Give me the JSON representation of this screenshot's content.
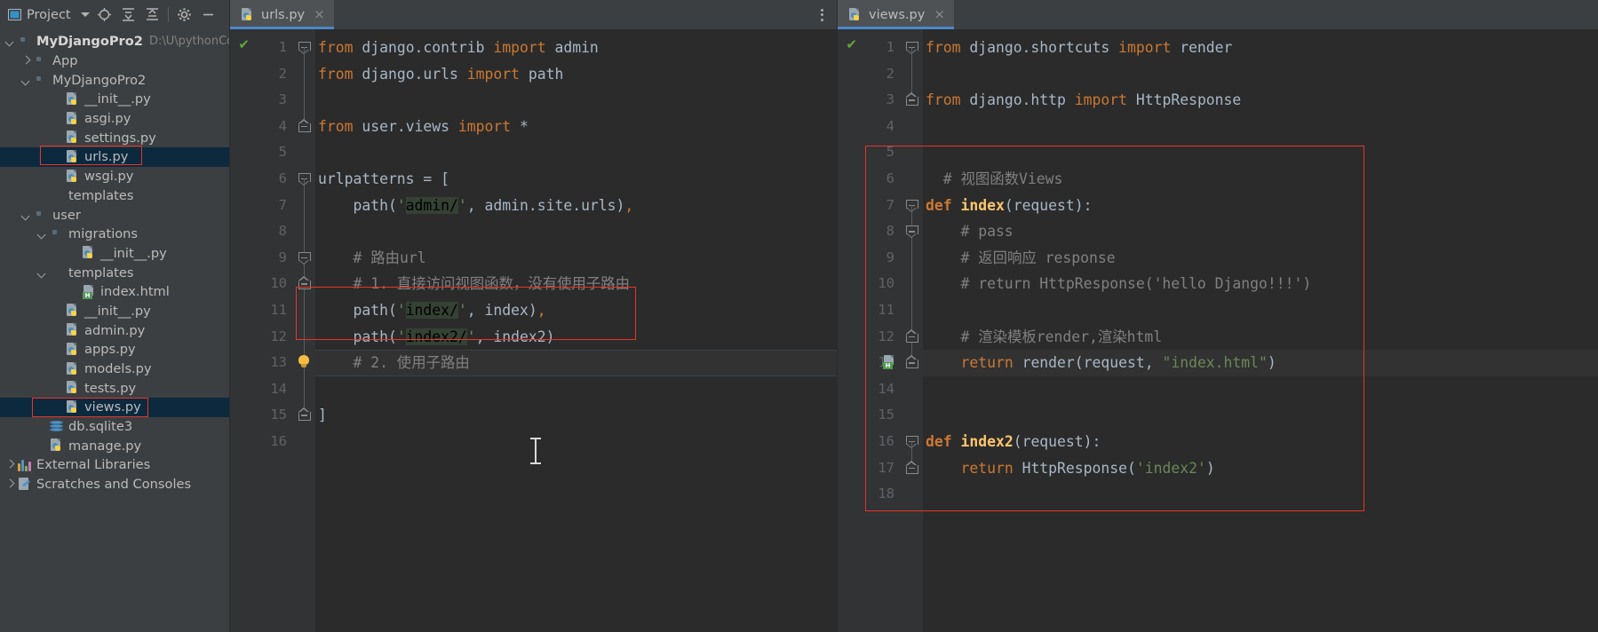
{
  "sidebar": {
    "toolbar": {
      "title": "Project",
      "dropdown_icon": "chevron-down-icon",
      "buttons": [
        {
          "name": "locate-icon",
          "glyph": "⊕"
        },
        {
          "name": "expand-all-icon",
          "glyph": "⤓"
        },
        {
          "name": "collapse-all-icon",
          "glyph": "⤒"
        },
        {
          "name": "settings-gear-icon",
          "glyph": "⚙"
        },
        {
          "name": "hide-icon",
          "glyph": "—"
        }
      ]
    },
    "tree": [
      {
        "label": "MyDjangoPro2",
        "path": "D:\\U\\pythonCode",
        "indent": 0,
        "arrow": "down",
        "icon": "folder-module",
        "bold": true,
        "selected": false
      },
      {
        "label": "App",
        "path": "",
        "indent": 1,
        "arrow": "right",
        "icon": "folder-module",
        "bold": false,
        "selected": false
      },
      {
        "label": "MyDjangoPro2",
        "path": "",
        "indent": 1,
        "arrow": "down",
        "icon": "folder-module",
        "bold": false,
        "selected": false
      },
      {
        "label": "__init__.py",
        "path": "",
        "indent": 3,
        "arrow": "none",
        "icon": "python-file",
        "bold": false,
        "selected": false
      },
      {
        "label": "asgi.py",
        "path": "",
        "indent": 3,
        "arrow": "none",
        "icon": "python-file",
        "bold": false,
        "selected": false
      },
      {
        "label": "settings.py",
        "path": "",
        "indent": 3,
        "arrow": "none",
        "icon": "python-file",
        "bold": false,
        "selected": false
      },
      {
        "label": "urls.py",
        "path": "",
        "indent": 3,
        "arrow": "none",
        "icon": "python-file",
        "bold": false,
        "selected": true
      },
      {
        "label": "wsgi.py",
        "path": "",
        "indent": 3,
        "arrow": "none",
        "icon": "python-file",
        "bold": false,
        "selected": false
      },
      {
        "label": "templates",
        "path": "",
        "indent": 2,
        "arrow": "none",
        "icon": "folder-purple",
        "bold": false,
        "selected": false
      },
      {
        "label": "user",
        "path": "",
        "indent": 1,
        "arrow": "down",
        "icon": "folder-module",
        "bold": false,
        "selected": false
      },
      {
        "label": "migrations",
        "path": "",
        "indent": 2,
        "arrow": "down",
        "icon": "folder-module",
        "bold": false,
        "selected": false
      },
      {
        "label": "__init__.py",
        "path": "",
        "indent": 4,
        "arrow": "none",
        "icon": "python-file",
        "bold": false,
        "selected": false
      },
      {
        "label": "templates",
        "path": "",
        "indent": 2,
        "arrow": "down",
        "icon": "folder-gray",
        "bold": false,
        "selected": false
      },
      {
        "label": "index.html",
        "path": "",
        "indent": 4,
        "arrow": "none",
        "icon": "html-file",
        "bold": false,
        "selected": false
      },
      {
        "label": "__init__.py",
        "path": "",
        "indent": 3,
        "arrow": "none",
        "icon": "python-file",
        "bold": false,
        "selected": false
      },
      {
        "label": "admin.py",
        "path": "",
        "indent": 3,
        "arrow": "none",
        "icon": "python-file",
        "bold": false,
        "selected": false
      },
      {
        "label": "apps.py",
        "path": "",
        "indent": 3,
        "arrow": "none",
        "icon": "python-file",
        "bold": false,
        "selected": false
      },
      {
        "label": "models.py",
        "path": "",
        "indent": 3,
        "arrow": "none",
        "icon": "python-file",
        "bold": false,
        "selected": false
      },
      {
        "label": "tests.py",
        "path": "",
        "indent": 3,
        "arrow": "none",
        "icon": "python-file",
        "bold": false,
        "selected": false
      },
      {
        "label": "views.py",
        "path": "",
        "indent": 3,
        "arrow": "none",
        "icon": "python-file",
        "bold": false,
        "selected": true
      },
      {
        "label": "db.sqlite3",
        "path": "",
        "indent": 2,
        "arrow": "none",
        "icon": "database-file",
        "bold": false,
        "selected": false
      },
      {
        "label": "manage.py",
        "path": "",
        "indent": 2,
        "arrow": "none",
        "icon": "python-file",
        "bold": false,
        "selected": false
      },
      {
        "label": "External Libraries",
        "path": "",
        "indent": 0,
        "arrow": "right",
        "icon": "library-icon",
        "bold": false,
        "selected": false
      },
      {
        "label": "Scratches and Consoles",
        "path": "",
        "indent": 0,
        "arrow": "right",
        "icon": "scratch-icon",
        "bold": false,
        "selected": false
      }
    ]
  },
  "left_editor": {
    "tab": {
      "label": "urls.py",
      "icon": "python-file",
      "close_glyph": "×",
      "active": true
    },
    "kebab_icon": "more-options-icon",
    "inspection_status": "✔",
    "line_numbers": [
      "1",
      "2",
      "3",
      "4",
      "5",
      "6",
      "7",
      "8",
      "9",
      "10",
      "11",
      "12",
      "13",
      "14",
      "15",
      "16"
    ],
    "lines": [
      {
        "n": 1,
        "tokens": [
          {
            "t": "from",
            "c": "kw"
          },
          {
            "t": " django.contrib ",
            "c": "txt"
          },
          {
            "t": "import",
            "c": "kw"
          },
          {
            "t": " admin",
            "c": "txt"
          }
        ]
      },
      {
        "n": 2,
        "tokens": [
          {
            "t": "from",
            "c": "kw"
          },
          {
            "t": " django.urls ",
            "c": "txt"
          },
          {
            "t": "import",
            "c": "kw"
          },
          {
            "t": " path",
            "c": "txt"
          }
        ]
      },
      {
        "n": 3,
        "tokens": []
      },
      {
        "n": 4,
        "tokens": [
          {
            "t": "from",
            "c": "kw"
          },
          {
            "t": " user.views ",
            "c": "txt"
          },
          {
            "t": "import",
            "c": "kw"
          },
          {
            "t": " *",
            "c": "txt"
          }
        ]
      },
      {
        "n": 5,
        "tokens": []
      },
      {
        "n": 6,
        "tokens": [
          {
            "t": "urlpatterns = [",
            "c": "txt"
          }
        ]
      },
      {
        "n": 7,
        "tokens": [
          {
            "t": "    path(",
            "c": "txt"
          },
          {
            "t": "'",
            "c": "str"
          },
          {
            "t": "admin/",
            "c": "hlstr"
          },
          {
            "t": "'",
            "c": "str"
          },
          {
            "t": ", admin.site.urls)",
            "c": "txt"
          },
          {
            "t": ",",
            "c": "kw"
          }
        ]
      },
      {
        "n": 8,
        "tokens": []
      },
      {
        "n": 9,
        "tokens": [
          {
            "t": "    # 路由url",
            "c": "cmt"
          }
        ]
      },
      {
        "n": 10,
        "tokens": [
          {
            "t": "    # 1. 直接访问视图函数，没有使用子路由",
            "c": "cmt"
          }
        ]
      },
      {
        "n": 11,
        "tokens": [
          {
            "t": "    path(",
            "c": "txt"
          },
          {
            "t": "'",
            "c": "str"
          },
          {
            "t": "index/",
            "c": "hlstr"
          },
          {
            "t": "'",
            "c": "str"
          },
          {
            "t": ", index)",
            "c": "txt"
          },
          {
            "t": ",",
            "c": "kw"
          }
        ]
      },
      {
        "n": 12,
        "tokens": [
          {
            "t": "    path(",
            "c": "txt"
          },
          {
            "t": "'",
            "c": "str"
          },
          {
            "t": "index2/",
            "c": "hlstr"
          },
          {
            "t": "'",
            "c": "str"
          },
          {
            "t": ", index2)",
            "c": "txt"
          }
        ]
      },
      {
        "n": 13,
        "tokens": [
          {
            "t": "    # 2. 使用子路由",
            "c": "cmt"
          }
        ]
      },
      {
        "n": 14,
        "tokens": []
      },
      {
        "n": 15,
        "tokens": [
          {
            "t": "]",
            "c": "txt"
          }
        ]
      },
      {
        "n": 16,
        "tokens": []
      }
    ],
    "annotations": {
      "bulb_line": 13,
      "caret_line": 13
    }
  },
  "right_editor": {
    "tab": {
      "label": "views.py",
      "icon": "python-file",
      "close_glyph": "×",
      "active": true
    },
    "kebab_icon": "more-options-icon",
    "inspection_status": "✔",
    "line_numbers": [
      "1",
      "2",
      "3",
      "4",
      "5",
      "6",
      "7",
      "8",
      "9",
      "10",
      "11",
      "12",
      "13",
      "14",
      "15",
      "16",
      "17",
      "18"
    ],
    "lines": [
      {
        "n": 1,
        "tokens": [
          {
            "t": "from",
            "c": "kw"
          },
          {
            "t": " django.shortcuts ",
            "c": "txt"
          },
          {
            "t": "import",
            "c": "kw"
          },
          {
            "t": " render",
            "c": "txt"
          }
        ]
      },
      {
        "n": 2,
        "tokens": []
      },
      {
        "n": 3,
        "tokens": [
          {
            "t": "from",
            "c": "kw"
          },
          {
            "t": " django.http ",
            "c": "txt"
          },
          {
            "t": "import",
            "c": "kw"
          },
          {
            "t": " HttpResponse",
            "c": "txt"
          }
        ]
      },
      {
        "n": 4,
        "tokens": []
      },
      {
        "n": 5,
        "tokens": []
      },
      {
        "n": 6,
        "tokens": [
          {
            "t": "  # 视图函数Views",
            "c": "cmt"
          }
        ]
      },
      {
        "n": 7,
        "tokens": [
          {
            "t": "def",
            "c": "kw-b"
          },
          {
            "t": " ",
            "c": "txt"
          },
          {
            "t": "index",
            "c": "fn-b"
          },
          {
            "t": "(request):",
            "c": "txt"
          }
        ]
      },
      {
        "n": 8,
        "tokens": [
          {
            "t": "    # pass",
            "c": "cmt"
          }
        ]
      },
      {
        "n": 9,
        "tokens": [
          {
            "t": "    # 返回响应 response",
            "c": "cmt"
          }
        ]
      },
      {
        "n": 10,
        "tokens": [
          {
            "t": "    # return HttpResponse('hello Django!!!')",
            "c": "cmt"
          }
        ]
      },
      {
        "n": 11,
        "tokens": []
      },
      {
        "n": 12,
        "tokens": [
          {
            "t": "    # 渲染模板render,渲染html",
            "c": "cmt"
          }
        ]
      },
      {
        "n": 13,
        "tokens": [
          {
            "t": "    ",
            "c": "txt"
          },
          {
            "t": "return",
            "c": "kw"
          },
          {
            "t": " render(request, ",
            "c": "txt"
          },
          {
            "t": "\"index.html\"",
            "c": "str"
          },
          {
            "t": ")",
            "c": "txt"
          }
        ]
      },
      {
        "n": 14,
        "tokens": []
      },
      {
        "n": 15,
        "tokens": []
      },
      {
        "n": 16,
        "tokens": [
          {
            "t": "def",
            "c": "kw-b"
          },
          {
            "t": " ",
            "c": "txt"
          },
          {
            "t": "index2",
            "c": "fn-b"
          },
          {
            "t": "(request):",
            "c": "txt"
          }
        ]
      },
      {
        "n": 17,
        "tokens": [
          {
            "t": "    ",
            "c": "txt"
          },
          {
            "t": "return",
            "c": "kw"
          },
          {
            "t": " HttpResponse(",
            "c": "txt"
          },
          {
            "t": "'index2'",
            "c": "str"
          },
          {
            "t": ")",
            "c": "txt"
          }
        ]
      },
      {
        "n": 18,
        "tokens": []
      }
    ],
    "annotations": {
      "html_marker_line": 13
    }
  },
  "highlights": {
    "color": "#e8342a",
    "boxes": [
      {
        "name": "sidebar-urls-py-highlight"
      },
      {
        "name": "sidebar-views-py-highlight"
      },
      {
        "name": "left-editor-path-lines-highlight"
      },
      {
        "name": "right-editor-views-block-highlight"
      }
    ]
  },
  "cursor": {
    "name": "text-ibeam-cursor"
  }
}
